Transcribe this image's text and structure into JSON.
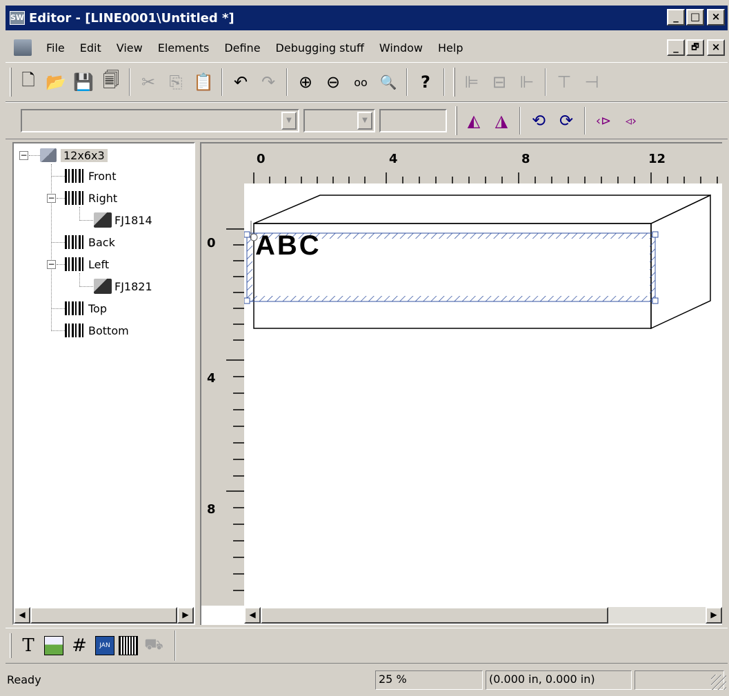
{
  "window": {
    "title": "Editor - [LINE0001\\Untitled *]",
    "app_icon_text": "SW",
    "buttons": {
      "minimize": "_",
      "maximize": "□",
      "close": "×"
    }
  },
  "menu": {
    "items": [
      "File",
      "Edit",
      "View",
      "Elements",
      "Define",
      "Debugging stuff",
      "Window",
      "Help"
    ],
    "mdi_buttons": {
      "minimize": "_",
      "restore": "🗗",
      "close": "×"
    }
  },
  "toolbar1": {
    "icons": [
      "new-doc-icon",
      "open-folder-icon",
      "save-icon",
      "save-all-icon",
      "cut-icon",
      "copy-icon",
      "paste-icon",
      "undo-icon",
      "redo-icon",
      "zoom-in-icon",
      "zoom-out-icon",
      "glasses-icon",
      "zoom-custom-icon",
      "help-icon",
      "align-left-icon",
      "align-center-icon",
      "align-right-icon",
      "align-top-icon",
      "align-middle-icon"
    ],
    "glyphs": [
      "🗋",
      "📂",
      "💾",
      "🗐",
      "✂",
      "⎘",
      "📋",
      "↶",
      "↷",
      "⊕",
      "⊖",
      "oo",
      "🔍",
      "?",
      "⊫",
      "⊟",
      "⊩",
      "⊤",
      "⊣"
    ]
  },
  "toolbar2": {
    "font_combo_value": "",
    "size_combo_value": "",
    "extra_field_value": "",
    "icons": [
      "mirror-left-icon",
      "mirror-right-icon",
      "rotate-ccw-icon",
      "rotate-cw-icon",
      "flip-h-icon",
      "flip-v-icon"
    ],
    "glyphs": [
      "◭",
      "◮",
      "⟲",
      "⟳",
      "‹⊳",
      "◃›"
    ]
  },
  "tree": {
    "root": "12x6x3",
    "nodes": [
      {
        "label": "Front"
      },
      {
        "label": "Right",
        "children": [
          "FJ1814"
        ]
      },
      {
        "label": "Back"
      },
      {
        "label": "Left",
        "children": [
          "FJ1821"
        ]
      },
      {
        "label": "Top"
      },
      {
        "label": "Bottom"
      }
    ]
  },
  "ruler": {
    "horizontal_labels": [
      "0",
      "4",
      "8",
      "12"
    ],
    "vertical_labels": [
      "0",
      "4",
      "8"
    ]
  },
  "canvas": {
    "text_element": "ABC"
  },
  "element_toolbar": {
    "icons": [
      "text-tool-icon",
      "image-tool-icon",
      "counter-tool-icon",
      "date-tool-icon",
      "barcode-tool-icon",
      "printhead-tool-icon"
    ],
    "glyphs": [
      "T",
      "",
      "#",
      "JAN",
      "",
      "⛟"
    ]
  },
  "status": {
    "message": "Ready",
    "zoom": "25 %",
    "coordinates": "(0.000 in, 0.000 in)"
  }
}
